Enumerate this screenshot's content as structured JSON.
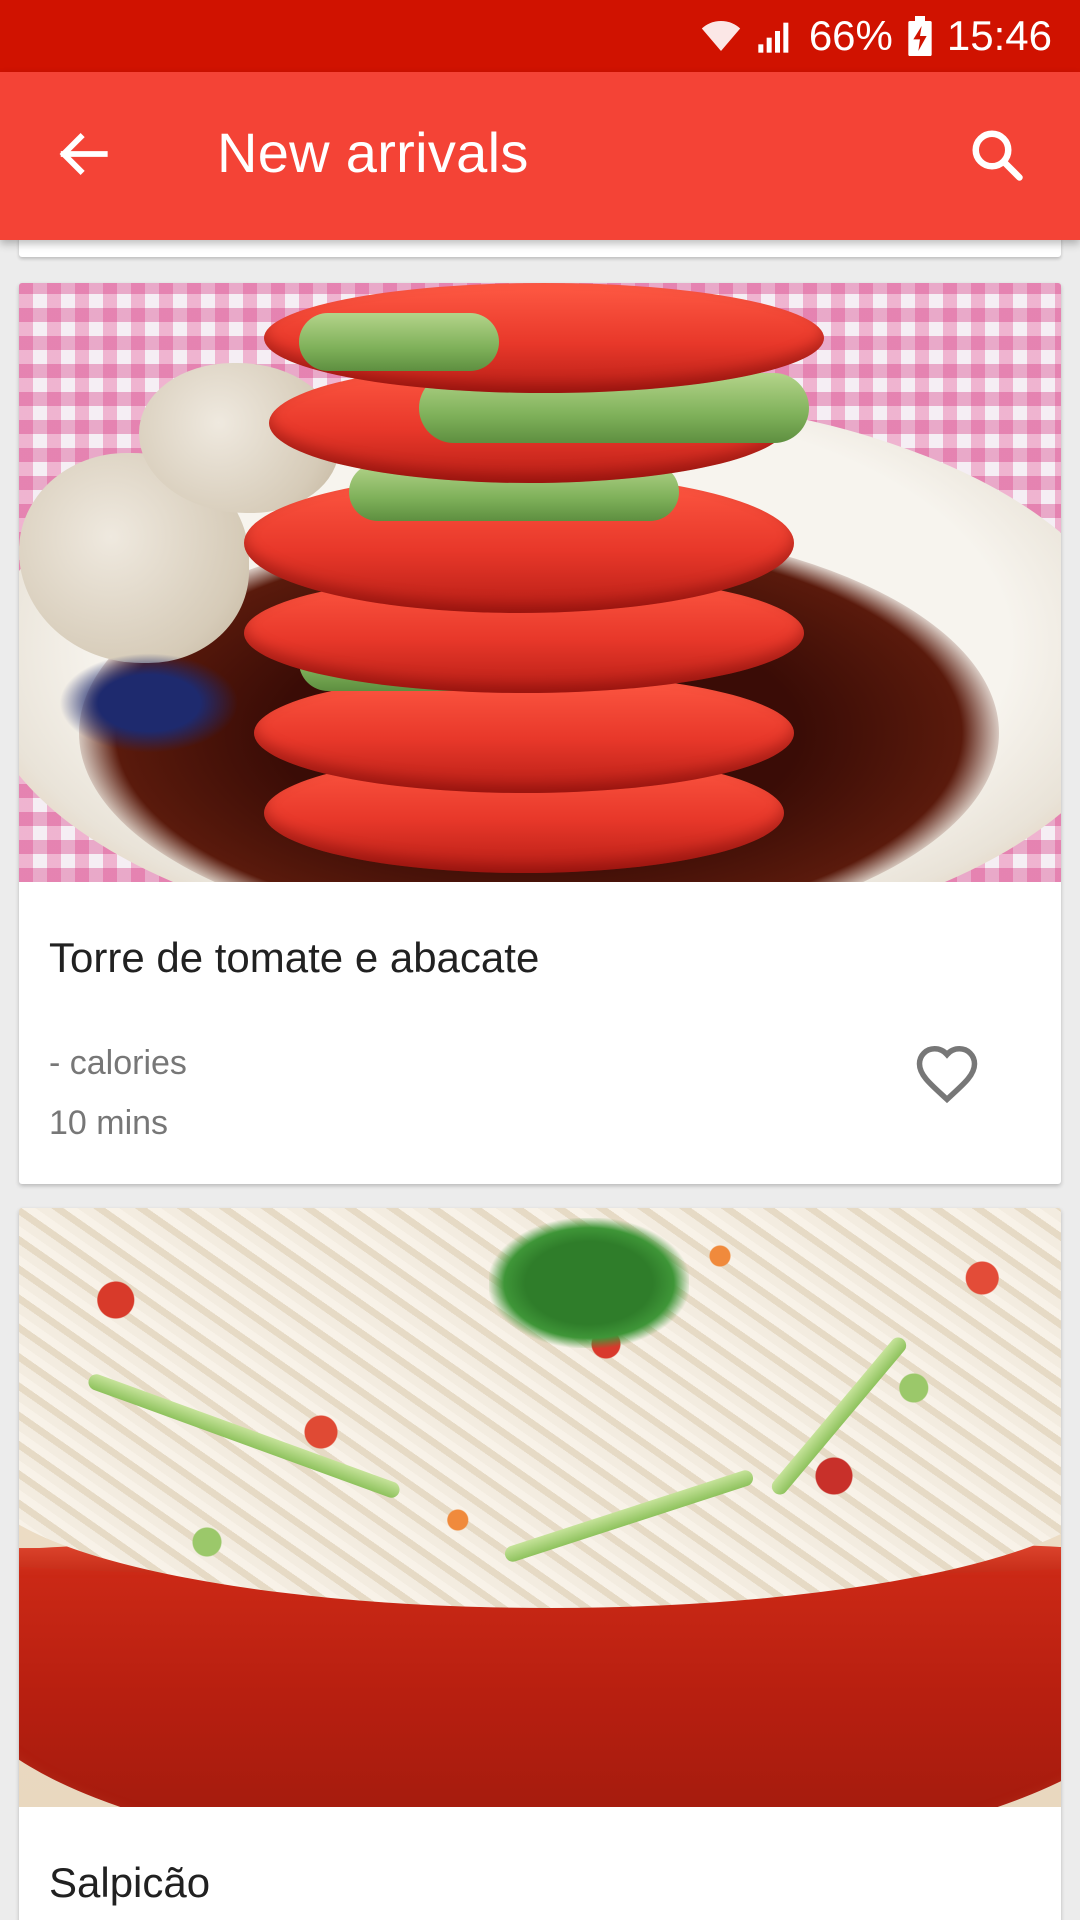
{
  "status_bar": {
    "battery": "66%",
    "time": "15:46"
  },
  "app_bar": {
    "title": "New arrivals"
  },
  "recipes": [
    {
      "name": "Torre de tomate e abacate",
      "calories": "- calories",
      "duration": "10 mins"
    },
    {
      "name": "Salpicão"
    }
  ],
  "colors": {
    "status_bar": "#d01200",
    "app_bar": "#f44336",
    "background": "#ececec"
  },
  "icons": {
    "back": "arrow-left-icon",
    "search": "search-icon",
    "favorite": "heart-outline-icon"
  }
}
